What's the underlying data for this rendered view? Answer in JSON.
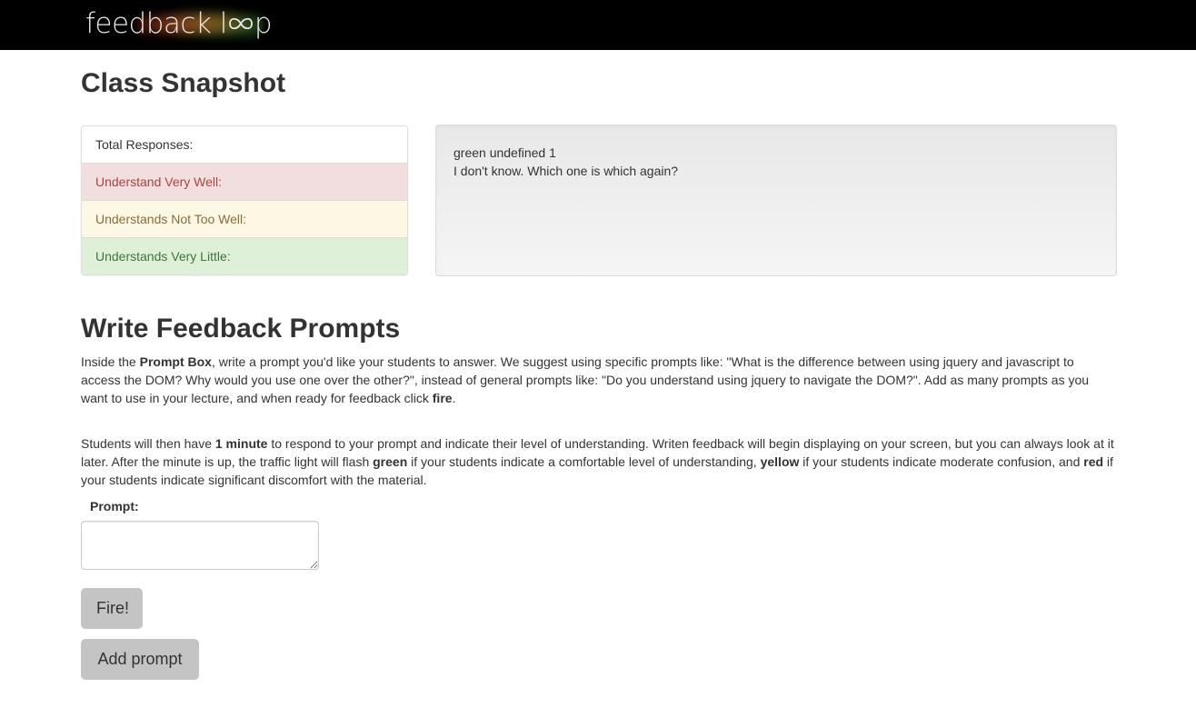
{
  "brand": {
    "logo_text_main": "feedback l",
    "logo_text_tail": "p"
  },
  "snapshot": {
    "title": "Class Snapshot",
    "stats": [
      {
        "label": "Total Responses:"
      },
      {
        "label": "Understand Very Well:"
      },
      {
        "label": "Understands Not Too Well:"
      },
      {
        "label": "Understands Very Little:"
      }
    ],
    "feedback": {
      "line1": "green undefined 1",
      "line2": "I don't know. Which one is which again?"
    }
  },
  "prompts": {
    "title": "Write Feedback Prompts",
    "para1": {
      "t1": "Inside the ",
      "b1": "Prompt Box",
      "t2": ", write a prompt you'd like your students to answer. We suggest using specific prompts like: \"What is the difference between using jquery and javascript to access the DOM? Why would you use one over the other?\", instead of general prompts like: \"Do you understand using jquery to navigate the DOM?\". Add as many prompts as you want to use in your lecture, and when ready for feedback click ",
      "b2": "fire",
      "t3": "."
    },
    "para2": {
      "t1": "Students will then have ",
      "b1": "1 minute",
      "t2": " to respond to your prompt and indicate their level of understanding. Writen feedback will begin displaying on your screen, but you can always look at it later. After the minute is up, the traffic light will flash ",
      "b2": "green",
      "t3": " if your students indicate a comfortable level of understanding, ",
      "b3": "yellow",
      "t4": " if your students indicate moderate confusion, and ",
      "b4": "red",
      "t5": " if your students indicate significant discomfort with the material."
    },
    "prompt_label": "Prompt:",
    "prompt_value": "",
    "fire_button": "Fire!",
    "add_button": "Add prompt"
  }
}
